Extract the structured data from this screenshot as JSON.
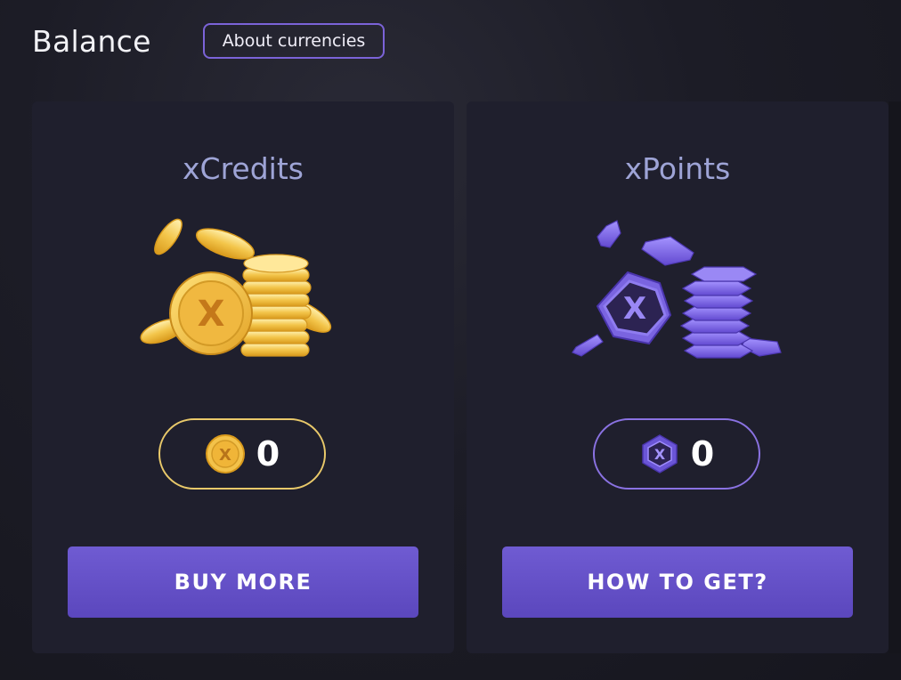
{
  "header": {
    "title": "Balance",
    "about_label": "About currencies"
  },
  "cards": [
    {
      "title": "xCredits",
      "icon": "gold-coin-stack-icon",
      "balance_icon": "gold-coin-icon",
      "balance": "0",
      "accent": "#e9c96a",
      "button_label": "BUY MORE"
    },
    {
      "title": "xPoints",
      "icon": "purple-hex-coin-stack-icon",
      "balance_icon": "purple-hex-coin-icon",
      "balance": "0",
      "accent": "#8a72e2",
      "button_label": "HOW TO GET?"
    }
  ],
  "colors": {
    "background": "#1c1c26",
    "card": "#1f1f2d",
    "button": "#6650c8",
    "title_text": "#9ea4d6"
  }
}
